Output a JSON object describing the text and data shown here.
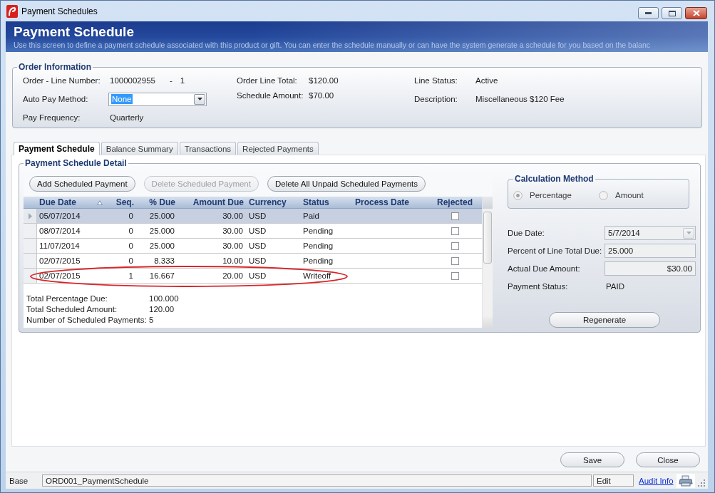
{
  "window": {
    "title": "Payment Schedules"
  },
  "header": {
    "title": "Payment Schedule",
    "subtitle": "Use this screen to define a payment schedule associated with this product or gift. You can enter the schedule manually or can have the system generate a schedule for you based on the balanc"
  },
  "order_information": {
    "title": "Order Information",
    "columns": [
      [
        {
          "kind": "line_number",
          "label": "Order - Line Number:",
          "value": "1000002955",
          "separator": "-",
          "line": "1"
        },
        {
          "kind": "dropdown",
          "label": "Auto Pay Method:",
          "value": "None",
          "text_selected": true,
          "disabled": false
        },
        {
          "kind": "text",
          "label": "Pay Frequency:",
          "value": "Quarterly"
        }
      ],
      [
        {
          "kind": "text",
          "label": "Order Line Total:",
          "value": "$120.00"
        },
        {
          "kind": "text",
          "label": "Schedule Amount:",
          "value": "$70.00"
        }
      ],
      [
        {
          "kind": "text",
          "label": "Line Status:",
          "value": "Active"
        },
        {
          "kind": "text",
          "label": "Description:",
          "value": "Miscellaneous $120 Fee"
        }
      ]
    ]
  },
  "tabs": [
    {
      "label": "Payment Schedule",
      "selected": true
    },
    {
      "label": "Balance Summary",
      "selected": false
    },
    {
      "label": "Transactions",
      "selected": false
    },
    {
      "label": "Rejected Payments",
      "selected": false
    }
  ],
  "schedule_detail": {
    "title": "Payment Schedule Detail",
    "buttons": [
      {
        "label": "Add Scheduled Payment",
        "disabled": false
      },
      {
        "label": "Delete Scheduled Payment",
        "disabled": true
      },
      {
        "label": "Delete All Unpaid Scheduled Payments",
        "disabled": false
      }
    ],
    "columns": [
      {
        "label": "Due Date",
        "kind": "date",
        "sorted": true
      },
      {
        "label": "Seq.",
        "kind": "number",
        "sorted": false
      },
      {
        "label": "% Due",
        "kind": "number",
        "sorted": false
      },
      {
        "label": "Amount Due",
        "kind": "number",
        "sorted": false
      },
      {
        "label": "Currency",
        "kind": "text",
        "sorted": false
      },
      {
        "label": "Status",
        "kind": "text",
        "sorted": false
      },
      {
        "label": "Process Date",
        "kind": "text",
        "sorted": false
      },
      {
        "label": "Rejected",
        "kind": "checkbox",
        "sorted": false
      }
    ],
    "rows": [
      {
        "selected": true,
        "circled": false,
        "rejected": false,
        "cells": [
          "05/07/2014",
          "0",
          "25.000",
          "30.00",
          "USD",
          "Paid",
          null
        ]
      },
      {
        "selected": false,
        "circled": false,
        "rejected": false,
        "cells": [
          "08/07/2014",
          "0",
          "25.000",
          "30.00",
          "USD",
          "Pending",
          null
        ]
      },
      {
        "selected": false,
        "circled": false,
        "rejected": false,
        "cells": [
          "11/07/2014",
          "0",
          "25.000",
          "30.00",
          "USD",
          "Pending",
          null
        ]
      },
      {
        "selected": false,
        "circled": false,
        "rejected": false,
        "cells": [
          "02/07/2015",
          "0",
          "8.333",
          "10.00",
          "USD",
          "Pending",
          null
        ]
      },
      {
        "selected": false,
        "circled": true,
        "rejected": false,
        "cells": [
          "02/07/2015",
          "1",
          "16.667",
          "20.00",
          "USD",
          "Writeoff",
          null
        ]
      }
    ],
    "totals": [
      {
        "label": "Total Percentage Due:",
        "value": "100.000"
      },
      {
        "label": "Total Scheduled Amount:",
        "value": "120.00"
      },
      {
        "label": "Number of Scheduled Payments:",
        "value": "5"
      }
    ]
  },
  "calculation_method": {
    "title": "Calculation Method",
    "disabled": true,
    "options": [
      {
        "label": "Percentage",
        "selected": true
      },
      {
        "label": "Amount",
        "selected": false
      }
    ]
  },
  "payment_fields": [
    {
      "kind": "dropdown",
      "label": "Due Date:",
      "value": "5/7/2014",
      "disabled": true
    },
    {
      "kind": "input",
      "label": "Percent of Line Total Due:",
      "value": "25.000",
      "disabled": true
    },
    {
      "kind": "amount",
      "label": "Actual Due Amount:",
      "value": "$30.00",
      "disabled": true
    },
    {
      "kind": "text",
      "label": "Payment Status:",
      "value": "PAID"
    }
  ],
  "regenerate_button": {
    "label": "Regenerate"
  },
  "footer_buttons": [
    {
      "label": "Save"
    },
    {
      "label": "Close"
    }
  ],
  "status_bar": {
    "mode": "Base",
    "form_name": "ORD001_PaymentSchedule",
    "state": "Edit",
    "link": "Audit Info"
  }
}
